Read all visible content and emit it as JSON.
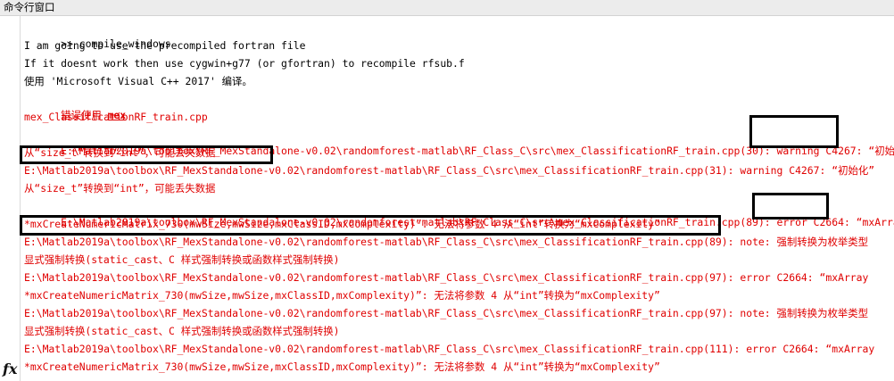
{
  "window": {
    "title": "命令行窗口"
  },
  "prompt": {
    "symbol": ">>",
    "command": " compile_windows"
  },
  "output": {
    "info_1": "I am going to use the precompiled fortran file",
    "info_2": "If it doesnt work then use cygwin+g77 (or gfortran) to recompile rfsub.f",
    "info_3": "使用 'Microsoft Visual C++ 2017' 编译。",
    "err_prefix": "错误使用 ",
    "err_link": "mex",
    "file": "mex_ClassificationRF_train.cpp",
    "l1": "E:\\Matlab2019a\\toolbox\\RF_MexStandalone-v0.02\\randomforest-matlab\\RF_Class_C\\src\\mex_ClassificationRF_train.cpp(30): ",
    "l1_code": "warning C4267",
    "l1_rest": ": “初始化”",
    "l2": "从“size_t”转换到“int”，可能丢失数据",
    "l3": "E:\\Matlab2019a\\toolbox\\RF_MexStandalone-v0.02\\randomforest-matlab\\RF_Class_C\\src\\mex_ClassificationRF_train.cpp(31): warning C4267: “初始化”",
    "l4": "从“size_t”转换到“int”，可能丢失数据",
    "l5": "E:\\Matlab2019a\\toolbox\\RF_MexStandalone-v0.02\\randomforest-matlab\\RF_Class_C\\src\\mex_ClassificationRF_train.cpp(89): ",
    "l5_code": "error C2664",
    "l5_rest": ": “mxArray",
    "l6": "*mxCreateNumericMatrix_730(mwSize,mwSize,mxClassID,mxComplexity)”: 无法将参数 4 从“int”转换为“mxComplexity”",
    "l7": "E:\\Matlab2019a\\toolbox\\RF_MexStandalone-v0.02\\randomforest-matlab\\RF_Class_C\\src\\mex_ClassificationRF_train.cpp(89): note: 强制转换为枚举类型",
    "l8": "显式强制转换(static_cast、C 样式强制转换或函数样式强制转换)",
    "l9": "E:\\Matlab2019a\\toolbox\\RF_MexStandalone-v0.02\\randomforest-matlab\\RF_Class_C\\src\\mex_ClassificationRF_train.cpp(97): error C2664: “mxArray",
    "l10": "*mxCreateNumericMatrix_730(mwSize,mwSize,mxClassID,mxComplexity)”: 无法将参数 4 从“int”转换为“mxComplexity”",
    "l11": "E:\\Matlab2019a\\toolbox\\RF_MexStandalone-v0.02\\randomforest-matlab\\RF_Class_C\\src\\mex_ClassificationRF_train.cpp(97): note: 强制转换为枚举类型",
    "l12": "显式强制转换(static_cast、C 样式强制转换或函数样式强制转换)",
    "l13": "E:\\Matlab2019a\\toolbox\\RF_MexStandalone-v0.02\\randomforest-matlab\\RF_Class_C\\src\\mex_ClassificationRF_train.cpp(111): error C2664: “mxArray",
    "l14": "*mxCreateNumericMatrix_730(mwSize,mwSize,mxClassID,mxComplexity)”: 无法将参数 4 从“int”转换为“mxComplexity”"
  },
  "gutter": {
    "fx_symbol": "fx"
  },
  "colors": {
    "error_text": "#e00000",
    "normal_text": "#000000",
    "highlight_border": "#000000"
  }
}
